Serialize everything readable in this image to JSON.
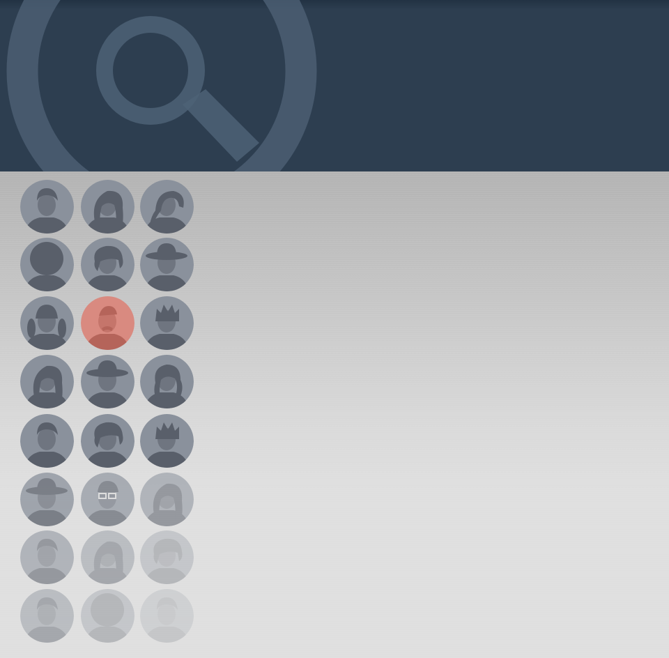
{
  "header": {
    "logo_icon": "magnifier-in-circle-icon",
    "colors": {
      "background": "#2d3e50",
      "topline": "#223243",
      "logo_stroke": "#4e6276"
    }
  },
  "content": {
    "background_top": "#b3b3b3",
    "background_bottom": "#dfdfdf"
  },
  "avatars": {
    "base_color": "#8a919c",
    "highlight_color": "#d98a80",
    "silhouette_color": "#595f6a",
    "highlight_silhouette_color": "#b5645a",
    "items": [
      {
        "icon": "bearded-man-avatar-icon",
        "hair": "short",
        "selected": false
      },
      {
        "icon": "long-haired-woman-avatar-icon",
        "hair": "long",
        "selected": false
      },
      {
        "icon": "ponytail-profile-avatar-icon",
        "hair": "ponytail",
        "selected": false
      },
      {
        "icon": "afro-woman-avatar-icon",
        "hair": "afro",
        "selected": false
      },
      {
        "icon": "curly-hair-avatar-icon",
        "hair": "curly",
        "selected": false
      },
      {
        "icon": "fedora-man-avatar-icon",
        "hair": "hat",
        "selected": false
      },
      {
        "icon": "pigtails-girl-avatar-icon",
        "hair": "pigtails",
        "selected": false
      },
      {
        "icon": "balding-mustache-man-avatar-icon",
        "hair": "bald",
        "selected": true
      },
      {
        "icon": "spiky-hair-avatar-icon",
        "hair": "spiky",
        "selected": false
      },
      {
        "icon": "long-straight-hair-woman-avatar-icon",
        "hair": "long",
        "selected": false
      },
      {
        "icon": "hat-goatee-man-avatar-icon",
        "hair": "hat",
        "selected": false
      },
      {
        "icon": "wavy-hair-woman-avatar-icon",
        "hair": "wavy",
        "selected": false
      },
      {
        "icon": "short-hair-man-avatar-icon",
        "hair": "short",
        "selected": false
      },
      {
        "icon": "curly-hair-woman-avatar-icon",
        "hair": "curly",
        "selected": false
      },
      {
        "icon": "quiff-man-avatar-icon",
        "hair": "spiky",
        "selected": false
      },
      {
        "icon": "cowboy-hat-avatar-icon",
        "hair": "hat",
        "selected": false
      },
      {
        "icon": "glasses-man-avatar-icon",
        "hair": "glasses",
        "selected": false
      },
      {
        "icon": "long-hair-profile-avatar-icon",
        "hair": "long",
        "selected": false
      },
      {
        "icon": "short-hair-boy-avatar-icon",
        "hair": "short",
        "selected": false
      },
      {
        "icon": "woman-with-phone-avatar-icon",
        "hair": "long",
        "selected": false
      },
      {
        "icon": "messy-hair-avatar-icon",
        "hair": "curly",
        "selected": false
      },
      {
        "icon": "smiling-man-avatar-icon",
        "hair": "short",
        "selected": false
      },
      {
        "icon": "curly-hair-child-avatar-icon",
        "hair": "afro",
        "selected": false
      },
      {
        "icon": "faded-avatar-icon",
        "hair": "short",
        "selected": false
      }
    ]
  }
}
